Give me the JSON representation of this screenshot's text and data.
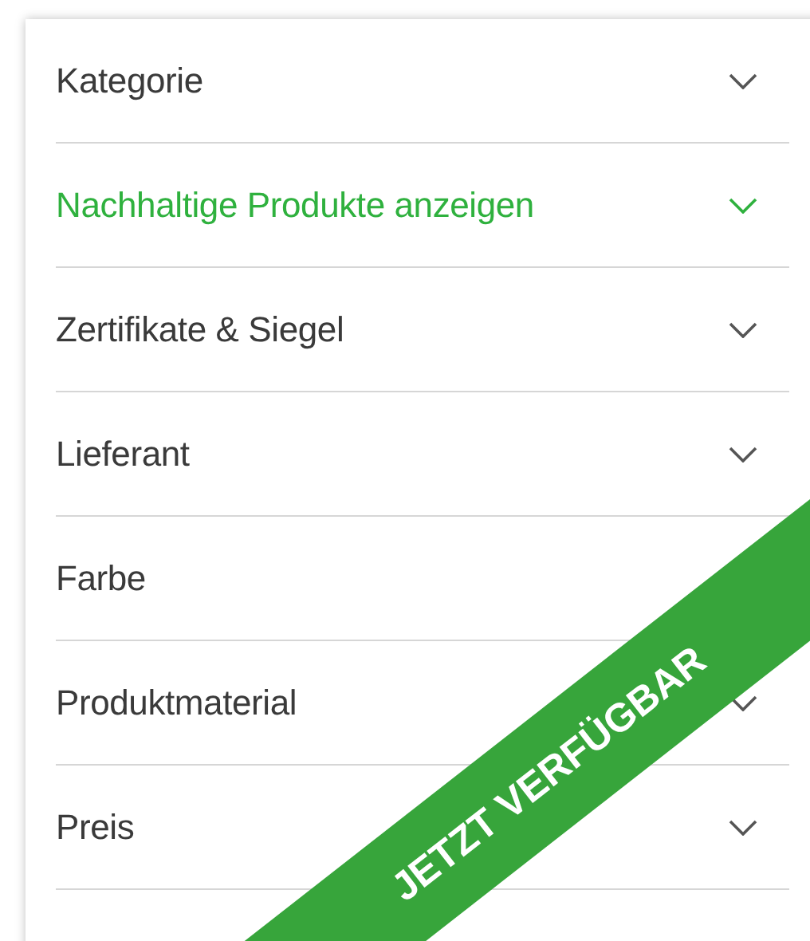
{
  "filters": [
    {
      "label": "Kategorie",
      "highlighted": false
    },
    {
      "label": "Nachhaltige Produkte anzeigen",
      "highlighted": true
    },
    {
      "label": "Zertifikate & Siegel",
      "highlighted": false
    },
    {
      "label": "Lieferant",
      "highlighted": false
    },
    {
      "label": "Farbe",
      "highlighted": false
    },
    {
      "label": "Produktmaterial",
      "highlighted": false
    },
    {
      "label": "Preis",
      "highlighted": false
    }
  ],
  "ribbon": {
    "text": "JETZT VERFÜGBAR"
  }
}
